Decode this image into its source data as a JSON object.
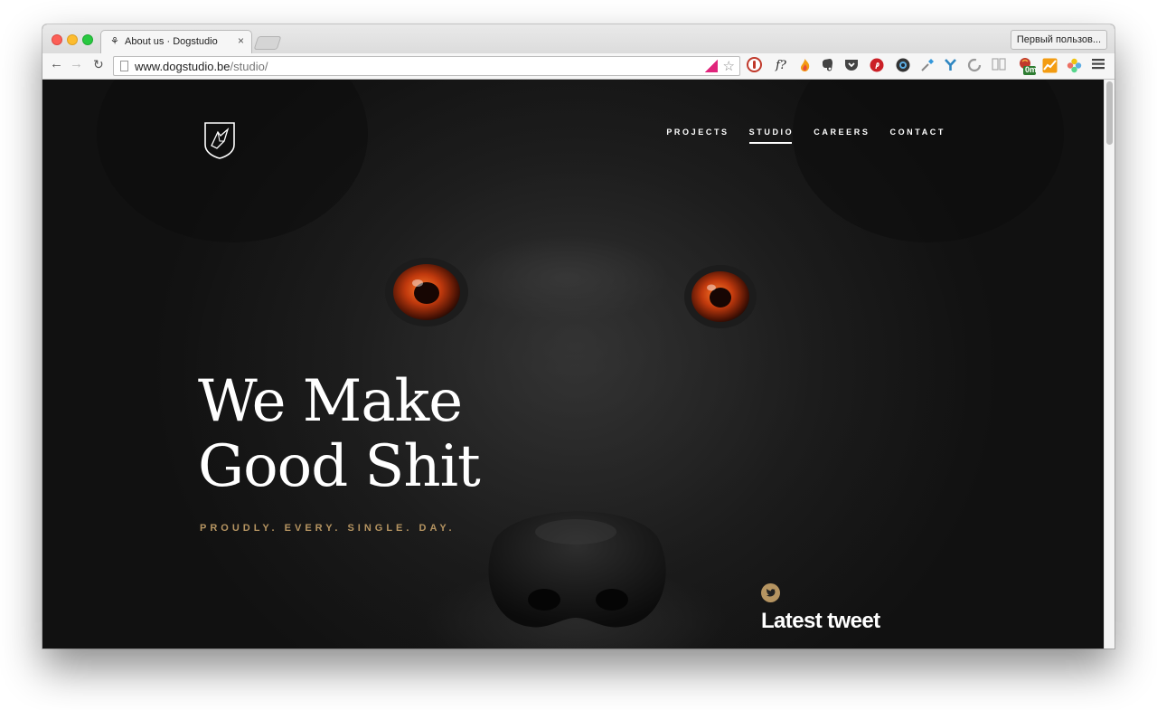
{
  "browser": {
    "tab_title": "About us · Dogstudio",
    "tab_close": "×",
    "profile_label": "Первый пользов...",
    "url_host": "www.dogstudio.be",
    "url_path": "/studio/",
    "extension_badge": "0m",
    "extensions": [
      "ublock-icon",
      "fonts-icon",
      "fire-icon",
      "evernote-icon",
      "pocket-icon",
      "pinterest-icon",
      "camera-icon",
      "eyedropper-icon",
      "y-icon",
      "loop-icon",
      "reader-icon",
      "badge-0m-icon",
      "chart-icon",
      "flower-icon"
    ]
  },
  "nav": {
    "items": [
      {
        "label": "PROJECTS"
      },
      {
        "label": "STUDIO",
        "active": true
      },
      {
        "label": "CAREERS"
      },
      {
        "label": "CONTACT"
      }
    ]
  },
  "hero": {
    "title": "We Make\nGood Shit",
    "subtitle": "PROUDLY. EVERY. SINGLE. DAY."
  },
  "tweet": {
    "heading": "Latest tweet"
  },
  "colors": {
    "accent": "#b59461",
    "page_background": "#141414"
  }
}
